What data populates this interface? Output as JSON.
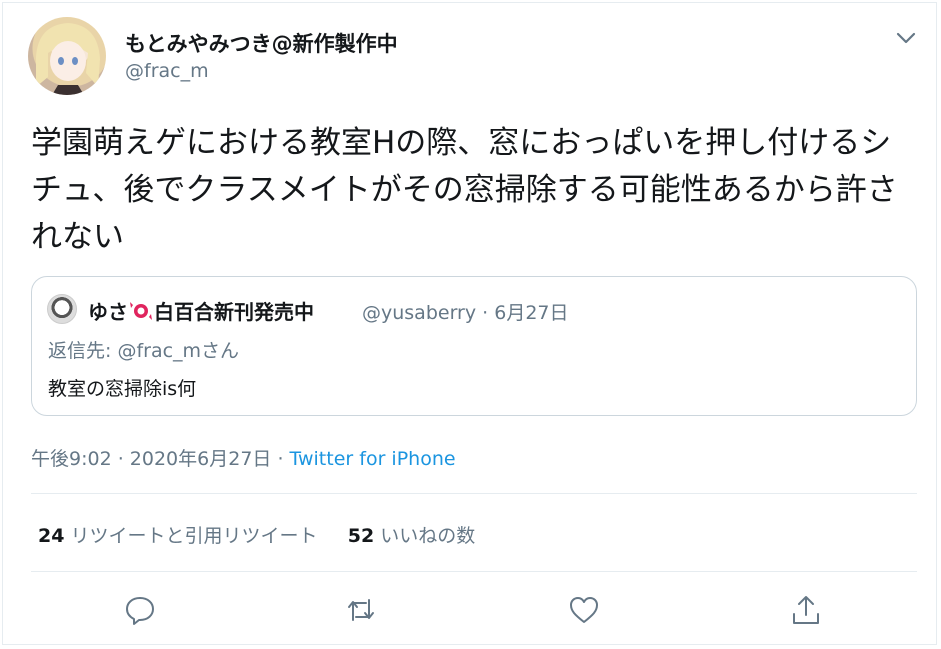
{
  "author": {
    "display_name": "もとみやみつき@新作製作中",
    "handle": "@frac_m"
  },
  "tweet": {
    "text": "学園萌えゲにおける教室Hの際、窓におっぱいを押し付けるシチュ、後でクラスメイトがその窓掃除する可能性あるから許されない",
    "time": "午後9:02 · 2020年6月27日",
    "separator": " · ",
    "source": "Twitter for iPhone"
  },
  "quoted": {
    "name_prefix": "ゆさ",
    "name_suffix": "白百合新刊発売中",
    "meta": "@yusaberry · 6月27日",
    "reply_to": "返信先: @frac_mさん",
    "text": "教室の窓掃除is何"
  },
  "stats": {
    "retweets_count": "24",
    "retweets_label": "リツイートと引用リツイート",
    "likes_count": "52",
    "likes_label": "いいねの数"
  },
  "icons": {
    "more": "chevron-down-icon",
    "reply": "reply-icon",
    "retweet": "retweet-icon",
    "like": "heart-icon",
    "share": "share-icon",
    "emoji": "candy-emoji"
  },
  "colors": {
    "text": "#14171a",
    "secondary": "#657786",
    "link": "#1b95e0",
    "border": "#e6ecf0"
  }
}
